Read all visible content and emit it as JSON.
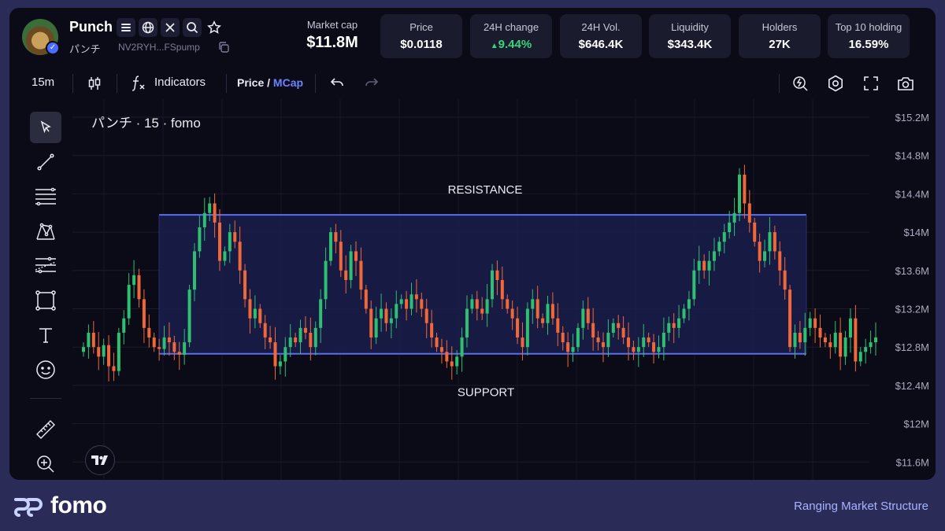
{
  "token": {
    "name": "Punch",
    "sub_name": "パンチ",
    "address": "NV2RYH...FSpump"
  },
  "stats": {
    "market_cap_label": "Market cap",
    "market_cap_value": "$11.8M",
    "price_label": "Price",
    "price_value": "$0.0118",
    "change_label": "24H change",
    "change_value": "9.44%",
    "volume_label": "24H Vol.",
    "volume_value": "$646.4K",
    "liquidity_label": "Liquidity",
    "liquidity_value": "$343.4K",
    "holders_label": "Holders",
    "holders_value": "27K",
    "top10_label": "Top 10 holding",
    "top10_value": "16.59%"
  },
  "toolbar": {
    "interval": "15m",
    "indicators_label": "Indicators",
    "price_label": "Price",
    "slash": "/",
    "mcap_label": "MCap"
  },
  "chart": {
    "legend": "パンチ · 15 · fomo",
    "resistance_label": "RESISTANCE",
    "support_label": "SUPPORT"
  },
  "footer": {
    "brand": "fomo",
    "caption": "Ranging Market Structure"
  },
  "colors": {
    "up": "#2fbf71",
    "down": "#f0683a",
    "accent": "#6a84ff",
    "zone_line": "#5a6ef0",
    "zone_fill": "#1a1d4a"
  },
  "icons": [
    "menu-icon",
    "globe-icon",
    "x-icon",
    "search-icon",
    "star-icon",
    "copy-icon",
    "candle-icon",
    "fx-icon",
    "undo-icon",
    "redo-icon",
    "lightning-icon",
    "settings-icon",
    "fullscreen-icon",
    "camera-icon",
    "cursor-icon",
    "trendline-icon",
    "fib-icon",
    "pattern-icon",
    "gann-icon",
    "rectangle-icon",
    "text-icon",
    "emoji-icon",
    "ruler-icon",
    "zoom-icon"
  ],
  "chart_data": {
    "type": "candlestick",
    "y_ticks": [
      "$15.2M",
      "$14.8M",
      "$14.4M",
      "$14M",
      "$13.6M",
      "$13.2M",
      "$12.8M",
      "$12.4M",
      "$12M",
      "$11.6M"
    ],
    "ylim": [
      11.5,
      15.3
    ],
    "y_unit": "M",
    "resistance": 14.18,
    "support": 12.73,
    "close": [
      12.8,
      12.95,
      12.8,
      12.7,
      12.82,
      12.6,
      12.55,
      12.95,
      13.1,
      13.45,
      13.55,
      13.3,
      13.0,
      12.9,
      12.8,
      12.78,
      12.9,
      12.85,
      12.75,
      12.72,
      12.85,
      13.4,
      13.8,
      14.05,
      14.2,
      14.3,
      14.1,
      13.7,
      13.8,
      14.0,
      13.9,
      13.6,
      13.3,
      13.1,
      13.2,
      13.05,
      12.9,
      12.85,
      12.6,
      12.65,
      12.8,
      12.9,
      12.85,
      13.0,
      12.95,
      12.8,
      13.0,
      13.3,
      13.7,
      14.0,
      13.9,
      13.6,
      13.5,
      13.8,
      13.7,
      13.4,
      13.2,
      12.9,
      13.1,
      13.2,
      13.05,
      13.1,
      13.25,
      13.3,
      13.2,
      13.35,
      13.3,
      13.2,
      13.05,
      12.9,
      12.8,
      12.75,
      12.65,
      12.6,
      12.7,
      12.9,
      13.2,
      13.3,
      13.2,
      13.15,
      13.3,
      13.6,
      13.5,
      13.3,
      13.2,
      13.1,
      12.9,
      12.8,
      13.2,
      13.3,
      13.1,
      13.05,
      13.25,
      13.1,
      12.95,
      12.85,
      12.75,
      12.8,
      13.0,
      13.2,
      13.05,
      12.9,
      12.85,
      12.8,
      12.95,
      13.05,
      13.0,
      12.9,
      12.8,
      12.75,
      12.8,
      12.9,
      12.85,
      12.75,
      12.8,
      12.95,
      13.05,
      13.0,
      13.1,
      13.2,
      13.3,
      13.6,
      13.7,
      13.6,
      13.7,
      13.8,
      13.9,
      14.0,
      14.1,
      14.2,
      14.6,
      14.3,
      14.1,
      13.9,
      13.7,
      13.8,
      14.0,
      13.8,
      13.6,
      13.4,
      12.8,
      12.95,
      12.85,
      13.0,
      13.1,
      13.0,
      12.9,
      12.85,
      12.8,
      12.95,
      12.7,
      12.9,
      13.1,
      12.65,
      12.75,
      12.8,
      12.85,
      12.9
    ]
  }
}
